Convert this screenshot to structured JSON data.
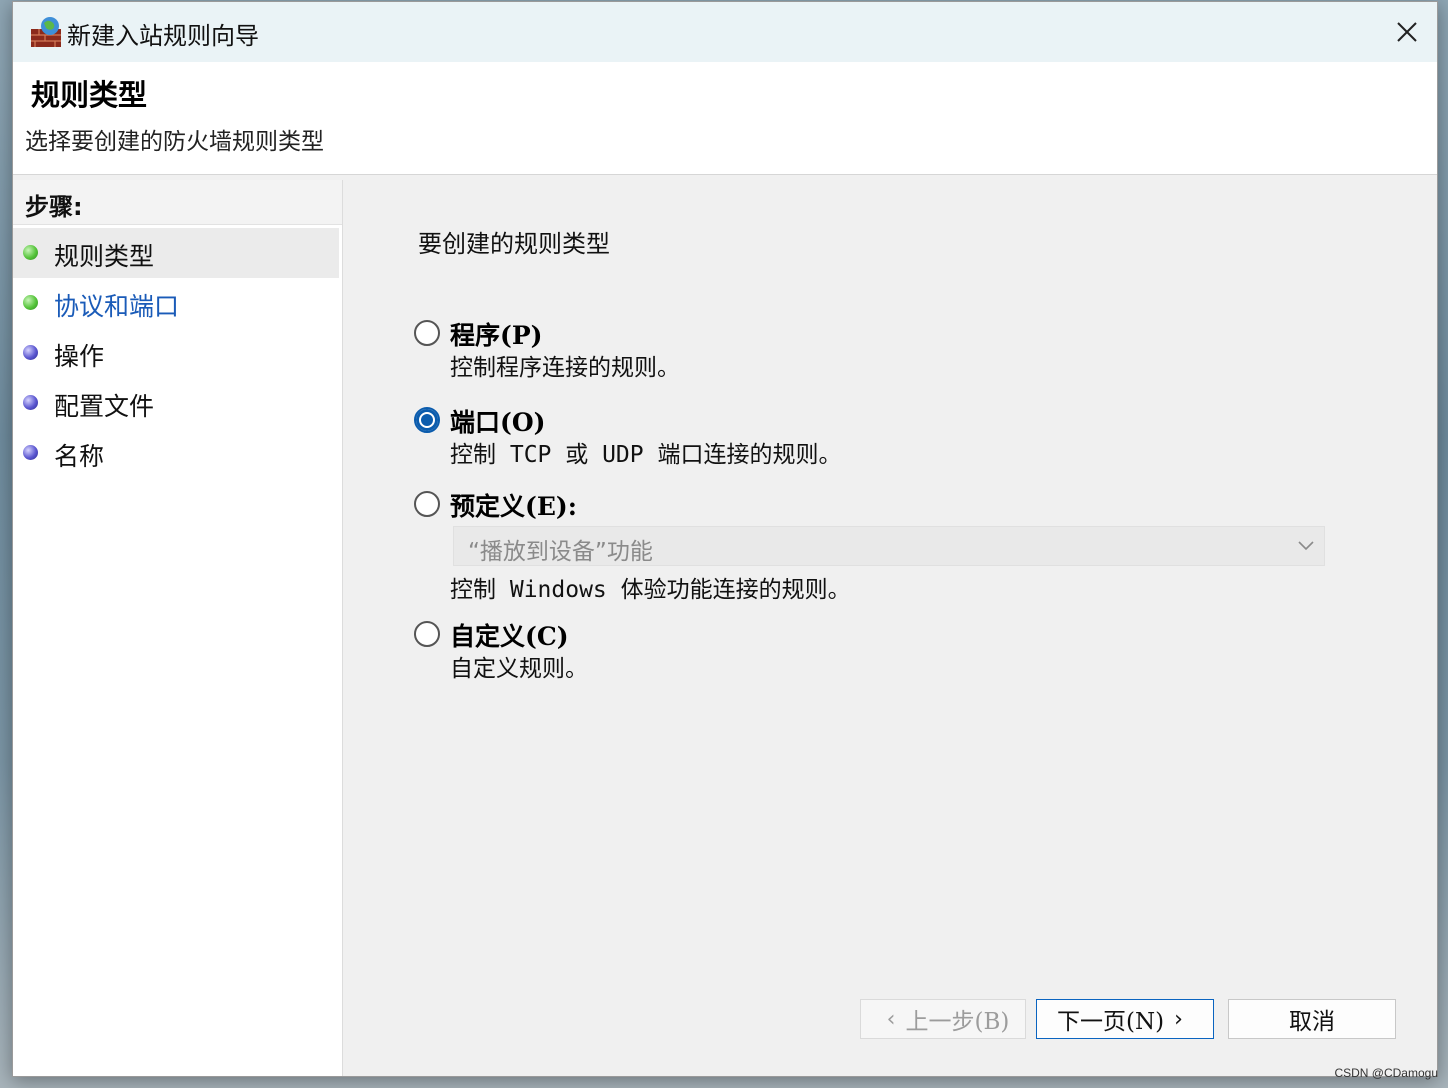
{
  "window": {
    "title": "新建入站规则向导",
    "close_icon": "close-icon"
  },
  "header": {
    "title": "规则类型",
    "subtitle": "选择要创建的防火墙规则类型"
  },
  "steps": {
    "title": "步骤:",
    "items": [
      {
        "label": "规则类型",
        "dot": "green",
        "state": "active"
      },
      {
        "label": "协议和端口",
        "dot": "green",
        "state": "link"
      },
      {
        "label": "操作",
        "dot": "blue",
        "state": "normal"
      },
      {
        "label": "配置文件",
        "dot": "blue",
        "state": "normal"
      },
      {
        "label": "名称",
        "dot": "blue",
        "state": "normal"
      }
    ]
  },
  "main": {
    "question": "要创建的规则类型",
    "options": [
      {
        "label": "程序(P)",
        "desc": "控制程序连接的规则。",
        "checked": false
      },
      {
        "label": "端口(O)",
        "desc": "控制 TCP 或 UDP 端口连接的规则。",
        "checked": true
      },
      {
        "label": "预定义(E):",
        "desc": "控制 Windows 体验功能连接的规则。",
        "checked": false
      },
      {
        "label": "自定义(C)",
        "desc": "自定义规则。",
        "checked": false
      }
    ],
    "predefined_select": {
      "value": "“播放到设备”功能",
      "disabled": true
    }
  },
  "buttons": {
    "back": "上一步(B)",
    "next": "下一页(N)",
    "cancel": "取消"
  },
  "watermark": "CSDN @CDamogu",
  "colors": {
    "accent": "#0b5cad",
    "link": "#1a5bb8",
    "titlebar": "#eaf3f6"
  }
}
